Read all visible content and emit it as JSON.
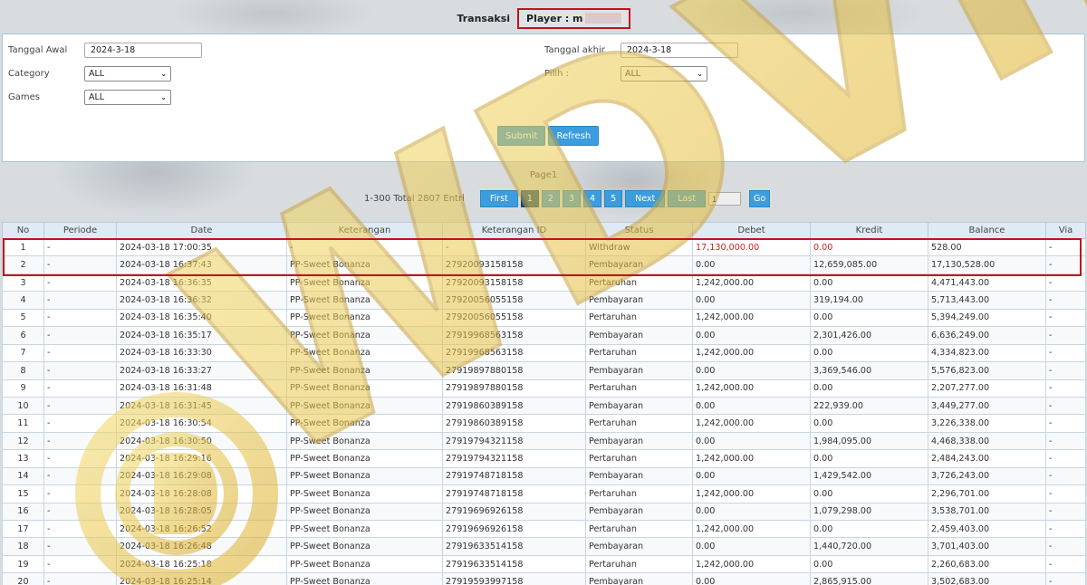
{
  "header": {
    "title": "Transaksi",
    "player_label": "Player : m"
  },
  "filters": {
    "tanggal_awal_label": "Tanggal Awal",
    "tanggal_awal_value": "2024-3-18",
    "tanggal_akhir_label": "Tanggal akhir",
    "tanggal_akhir_value": "2024-3-18",
    "category_label": "Category",
    "category_value": "ALL",
    "pilih_label": "Pilih  :",
    "pilih_value": "ALL",
    "games_label": "Games",
    "games_value": "ALL",
    "submit_label": "Submit",
    "refresh_label": "Refresh"
  },
  "pager": {
    "page_label": "Page1",
    "total_text": "1-300 Total 2807 Entri",
    "first": "First",
    "pages": [
      "1",
      "2",
      "3",
      "4",
      "5"
    ],
    "active_page": "1",
    "next": "Next",
    "last": "Last",
    "input_value": "1",
    "go": "Go"
  },
  "table": {
    "columns": [
      "No",
      "Periode",
      "Date",
      "Keterangan",
      "Keterangan ID",
      "Status",
      "Debet",
      "Kredit",
      "Balance",
      "Via"
    ],
    "rows": [
      [
        "1",
        "-",
        "2024-03-18 17:00:35",
        "-",
        "-",
        "Withdraw",
        "17,130,000.00",
        "0.00",
        "528.00",
        "-"
      ],
      [
        "2",
        "-",
        "2024-03-18 16:37:43",
        "PP-Sweet Bonanza",
        "27920093158158",
        "Pembayaran",
        "0.00",
        "12,659,085.00",
        "17,130,528.00",
        "-"
      ],
      [
        "3",
        "-",
        "2024-03-18 16:36:35",
        "PP-Sweet Bonanza",
        "27920093158158",
        "Pertaruhan",
        "1,242,000.00",
        "0.00",
        "4,471,443.00",
        "-"
      ],
      [
        "4",
        "-",
        "2024-03-18 16:36:32",
        "PP-Sweet Bonanza",
        "27920056055158",
        "Pembayaran",
        "0.00",
        "319,194.00",
        "5,713,443.00",
        "-"
      ],
      [
        "5",
        "-",
        "2024-03-18 16:35:40",
        "PP-Sweet Bonanza",
        "27920056055158",
        "Pertaruhan",
        "1,242,000.00",
        "0.00",
        "5,394,249.00",
        "-"
      ],
      [
        "6",
        "-",
        "2024-03-18 16:35:17",
        "PP-Sweet Bonanza",
        "27919968563158",
        "Pembayaran",
        "0.00",
        "2,301,426.00",
        "6,636,249.00",
        "-"
      ],
      [
        "7",
        "-",
        "2024-03-18 16:33:30",
        "PP-Sweet Bonanza",
        "27919968563158",
        "Pertaruhan",
        "1,242,000.00",
        "0.00",
        "4,334,823.00",
        "-"
      ],
      [
        "8",
        "-",
        "2024-03-18 16:33:27",
        "PP-Sweet Bonanza",
        "27919897880158",
        "Pembayaran",
        "0.00",
        "3,369,546.00",
        "5,576,823.00",
        "-"
      ],
      [
        "9",
        "-",
        "2024-03-18 16:31:48",
        "PP-Sweet Bonanza",
        "27919897880158",
        "Pertaruhan",
        "1,242,000.00",
        "0.00",
        "2,207,277.00",
        "-"
      ],
      [
        "10",
        "-",
        "2024-03-18 16:31:45",
        "PP-Sweet Bonanza",
        "27919860389158",
        "Pembayaran",
        "0.00",
        "222,939.00",
        "3,449,277.00",
        "-"
      ],
      [
        "11",
        "-",
        "2024-03-18 16:30:54",
        "PP-Sweet Bonanza",
        "27919860389158",
        "Pertaruhan",
        "1,242,000.00",
        "0.00",
        "3,226,338.00",
        "-"
      ],
      [
        "12",
        "-",
        "2024-03-18 16:30:50",
        "PP-Sweet Bonanza",
        "27919794321158",
        "Pembayaran",
        "0.00",
        "1,984,095.00",
        "4,468,338.00",
        "-"
      ],
      [
        "13",
        "-",
        "2024-03-18 16:29:16",
        "PP-Sweet Bonanza",
        "27919794321158",
        "Pertaruhan",
        "1,242,000.00",
        "0.00",
        "2,484,243.00",
        "-"
      ],
      [
        "14",
        "-",
        "2024-03-18 16:29:08",
        "PP-Sweet Bonanza",
        "27919748718158",
        "Pembayaran",
        "0.00",
        "1,429,542.00",
        "3,726,243.00",
        "-"
      ],
      [
        "15",
        "-",
        "2024-03-18 16:28:08",
        "PP-Sweet Bonanza",
        "27919748718158",
        "Pertaruhan",
        "1,242,000.00",
        "0.00",
        "2,296,701.00",
        "-"
      ],
      [
        "16",
        "-",
        "2024-03-18 16:28:05",
        "PP-Sweet Bonanza",
        "27919696926158",
        "Pembayaran",
        "0.00",
        "1,079,298.00",
        "3,538,701.00",
        "-"
      ],
      [
        "17",
        "-",
        "2024-03-18 16:26:52",
        "PP-Sweet Bonanza",
        "27919696926158",
        "Pertaruhan",
        "1,242,000.00",
        "0.00",
        "2,459,403.00",
        "-"
      ],
      [
        "18",
        "-",
        "2024-03-18 16:26:48",
        "PP-Sweet Bonanza",
        "27919633514158",
        "Pembayaran",
        "0.00",
        "1,440,720.00",
        "3,701,403.00",
        "-"
      ],
      [
        "19",
        "-",
        "2024-03-18 16:25:18",
        "PP-Sweet Bonanza",
        "27919633514158",
        "Pertaruhan",
        "1,242,000.00",
        "0.00",
        "2,260,683.00",
        "-"
      ],
      [
        "20",
        "-",
        "2024-03-18 16:25:14",
        "PP-Sweet Bonanza",
        "27919593997158",
        "Pembayaran",
        "0.00",
        "2,865,915.00",
        "3,502,683.00",
        "-"
      ]
    ]
  },
  "watermark": {
    "text": "WDVIK",
    "color": "#e8c23a"
  },
  "colors": {
    "accent": "#3b9ddd",
    "highlight_border": "#c0131c",
    "debit_red": "#d11e1e"
  }
}
